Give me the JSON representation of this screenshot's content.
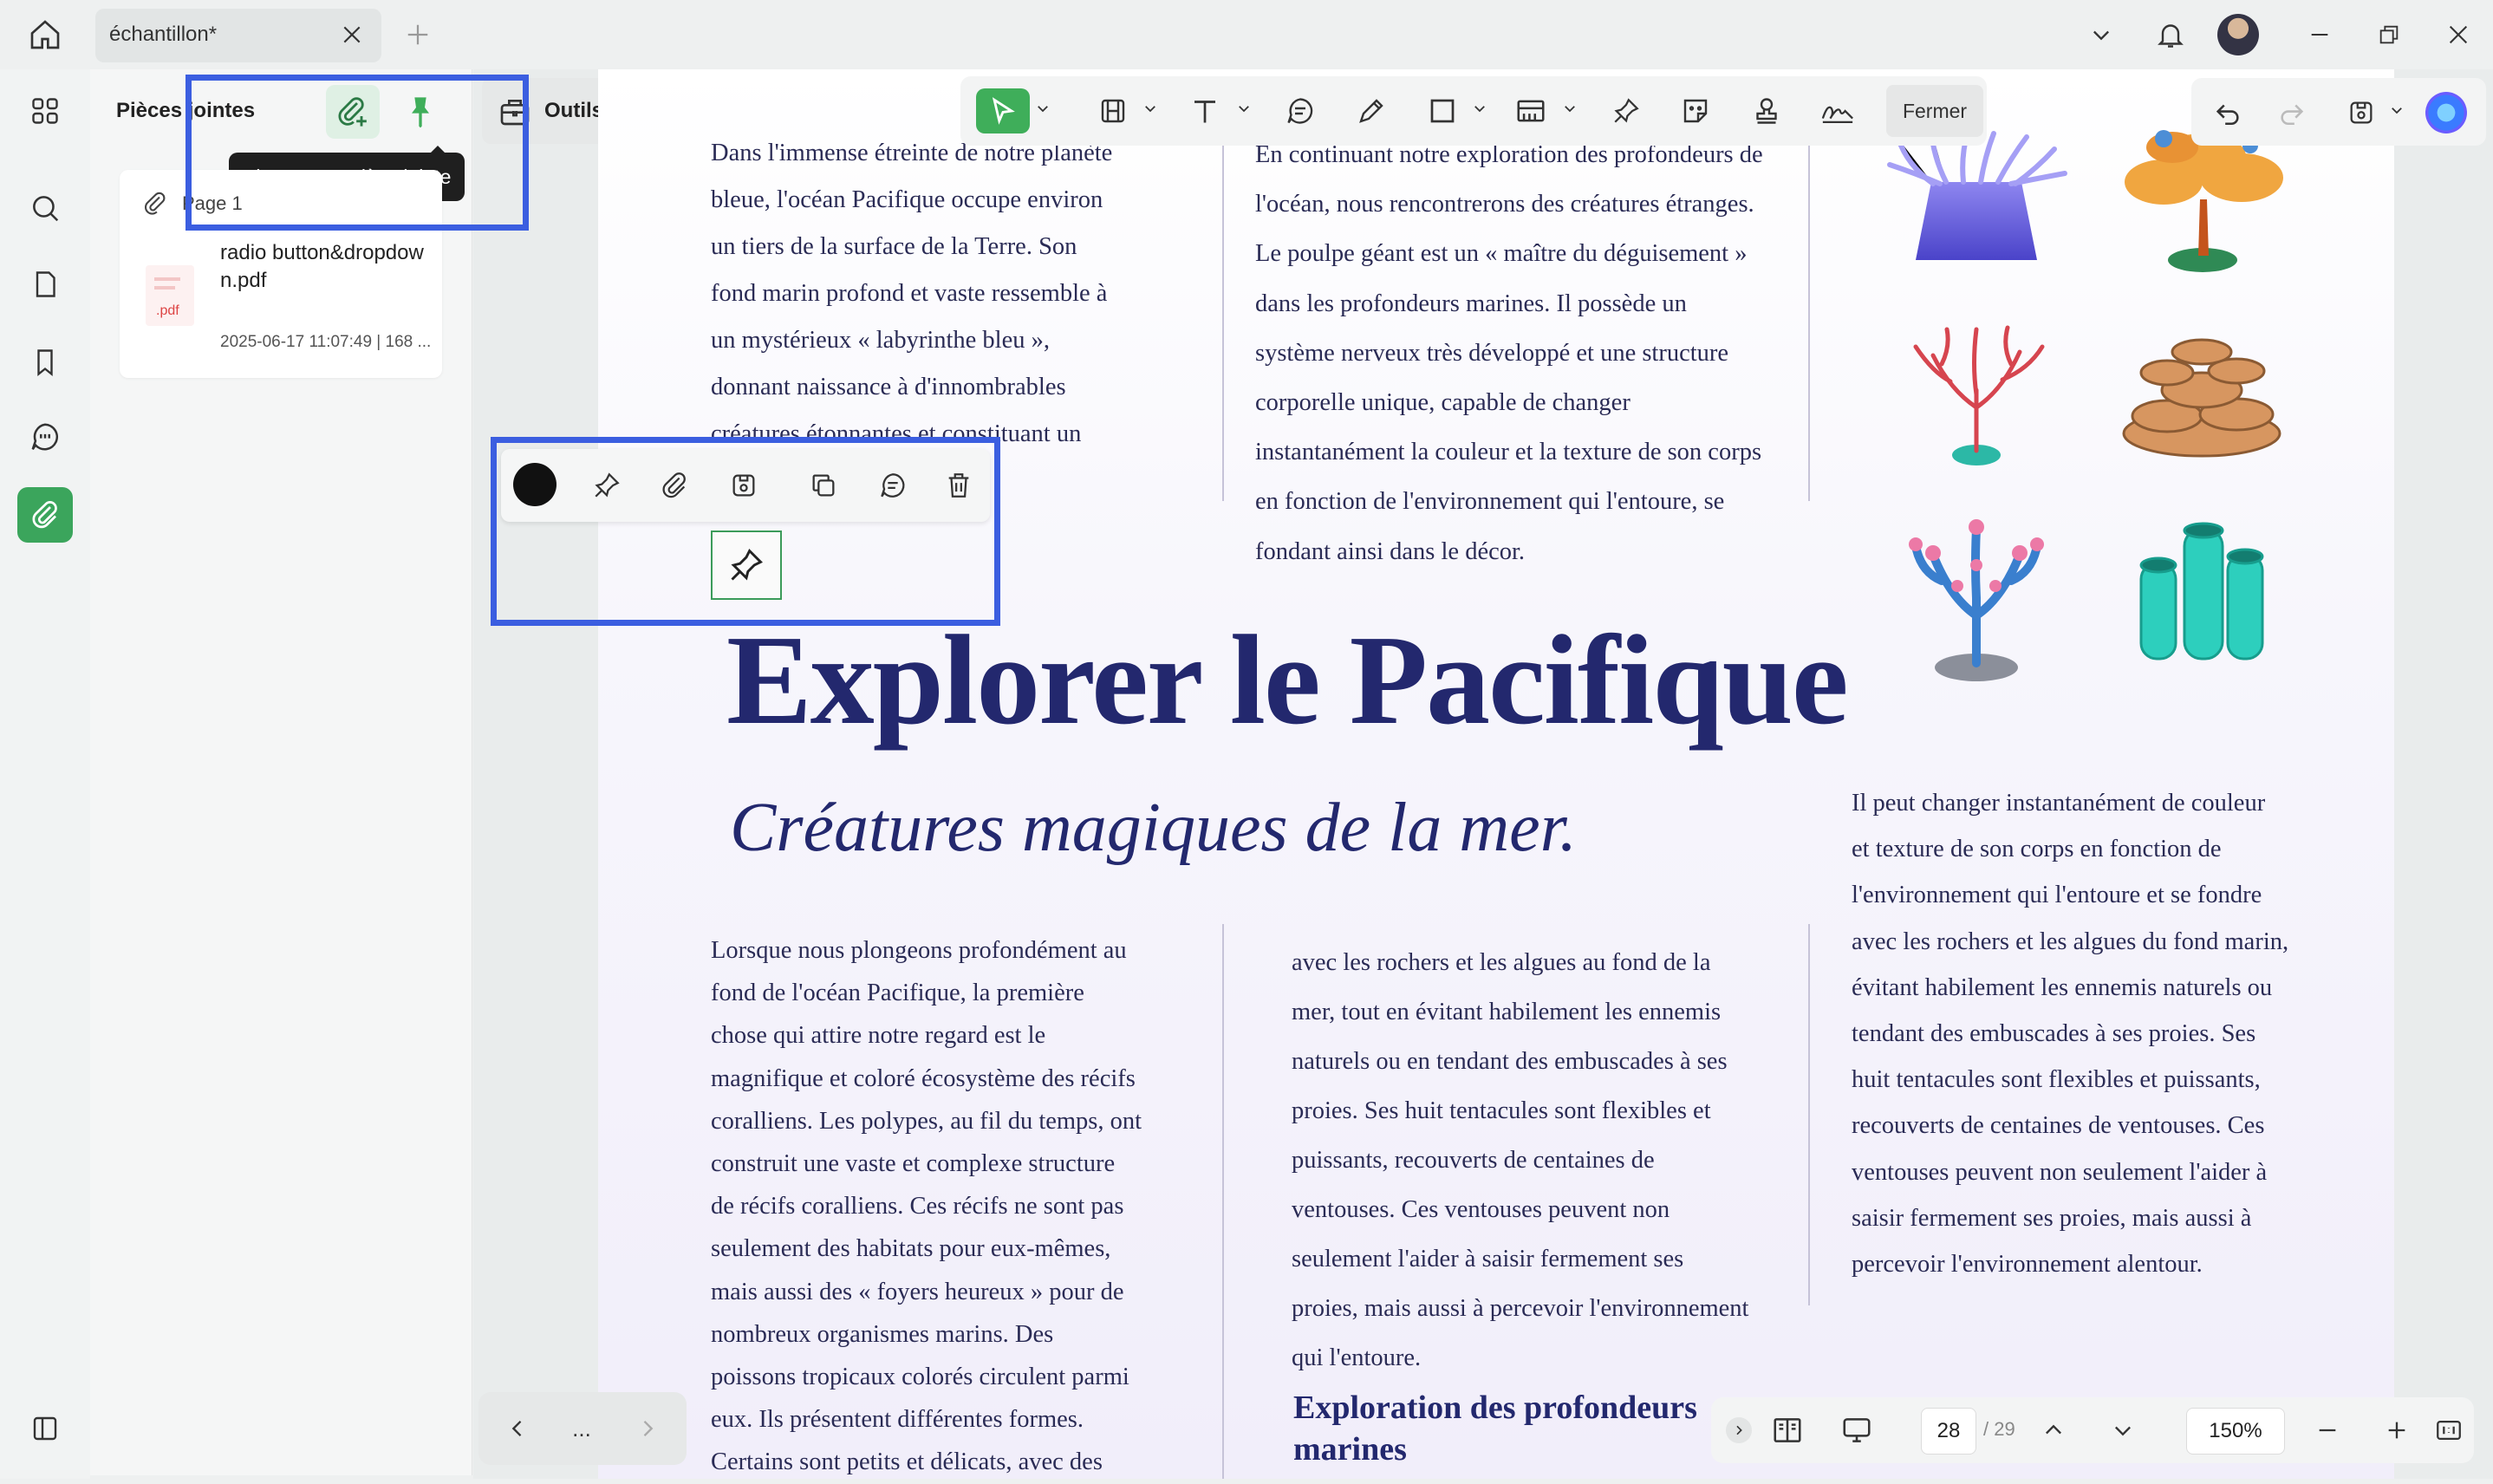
{
  "window": {
    "tab_title": "échantillon*"
  },
  "panel": {
    "title": "Pièces jointes",
    "tooltip": "Ajouter une pièce jointe",
    "card_page_label": "Page 1",
    "file_name": "radio button&dropdown.pdf",
    "file_ext": ".pdf",
    "file_meta": "2025-06-17 11:07:49 | 168 ..."
  },
  "toolbar": {
    "outils_label": "Outils",
    "fermer_label": "Fermer"
  },
  "document": {
    "col1_top": "Dans l'immense étreinte de notre planète\nbleue, l'océan Pacifique occupe environ\nun tiers de la surface de la Terre. Son\nfond marin profond et vaste ressemble à\nun mystérieux « labyrinthe bleu »,\ndonnant naissance à d'innombrables\ncréatures étonnantes et constituant un\nécosystème unique.",
    "col2_top": "En continuant notre exploration des profondeurs de\nl'océan, nous rencontrerons des créatures étranges.\nLe poulpe géant est un « maître du déguisement »\ndans les profondeurs marines. Il possède un\nsystème nerveux très développé et une structure\ncorporelle unique, capable de changer\ninstantanément la couleur et la texture de son corps\nen fonction de l'environnement qui l'entoure, se\nfondant ainsi dans le décor.",
    "title": "Explorer le Pacifique",
    "subtitle": "Créatures magiques de la mer.",
    "col1_bottom": "Lorsque nous plongeons profondément au\nfond de l'océan Pacifique, la première\nchose qui attire notre regard est le\nmagnifique et coloré écosystème des récifs\ncoralliens. Les polypes, au fil du temps, ont\nconstruit une vaste et complexe structure\nde récifs coralliens. Ces récifs ne sont pas\nseulement des habitats pour eux-mêmes,\nmais aussi des « foyers heureux » pour de\nnombreux organismes marins. Des\npoissons tropicaux colorés circulent parmi\neux. Ils présentent différentes formes.\nCertains sont petits et délicats, avec des",
    "col2_bottom": "avec les rochers et les algues au fond de la\nmer, tout en évitant habilement les ennemis\nnaturels ou en tendant des embuscades à ses\nproies. Ses huit tentacules sont flexibles et\npuissants, recouverts de centaines de\nventouses. Ces ventouses peuvent non\nseulement l'aider à saisir fermement ses\nproies, mais aussi à percevoir l'environnement\nqui l'entoure.",
    "col3_bottom": "Il peut changer instantanément de couleur\net texture de son corps en fonction de\nl'environnement qui l'entoure et se fondre\navec les rochers et les algues du fond marin,\névitant habilement les ennemis naturels ou\ntendant des embuscades à ses proies. Ses\nhuit tentacules sont flexibles et puissants,\nrecouverts de centaines de ventouses. Ces\nventouses peuvent non seulement l'aider à\nsaisir fermement ses proies, mais aussi à\npercevoir l'environnement alentour.",
    "section_heading": "Exploration des profondeurs marines"
  },
  "bottom_nav": {
    "more_label": "..."
  },
  "status": {
    "current_page": "28",
    "total_pages": "/ 29",
    "zoom": "150%"
  },
  "colors": {
    "accent_green": "#3fae5a",
    "highlight_blue": "#3b5ee0",
    "title_navy": "#23286e"
  }
}
